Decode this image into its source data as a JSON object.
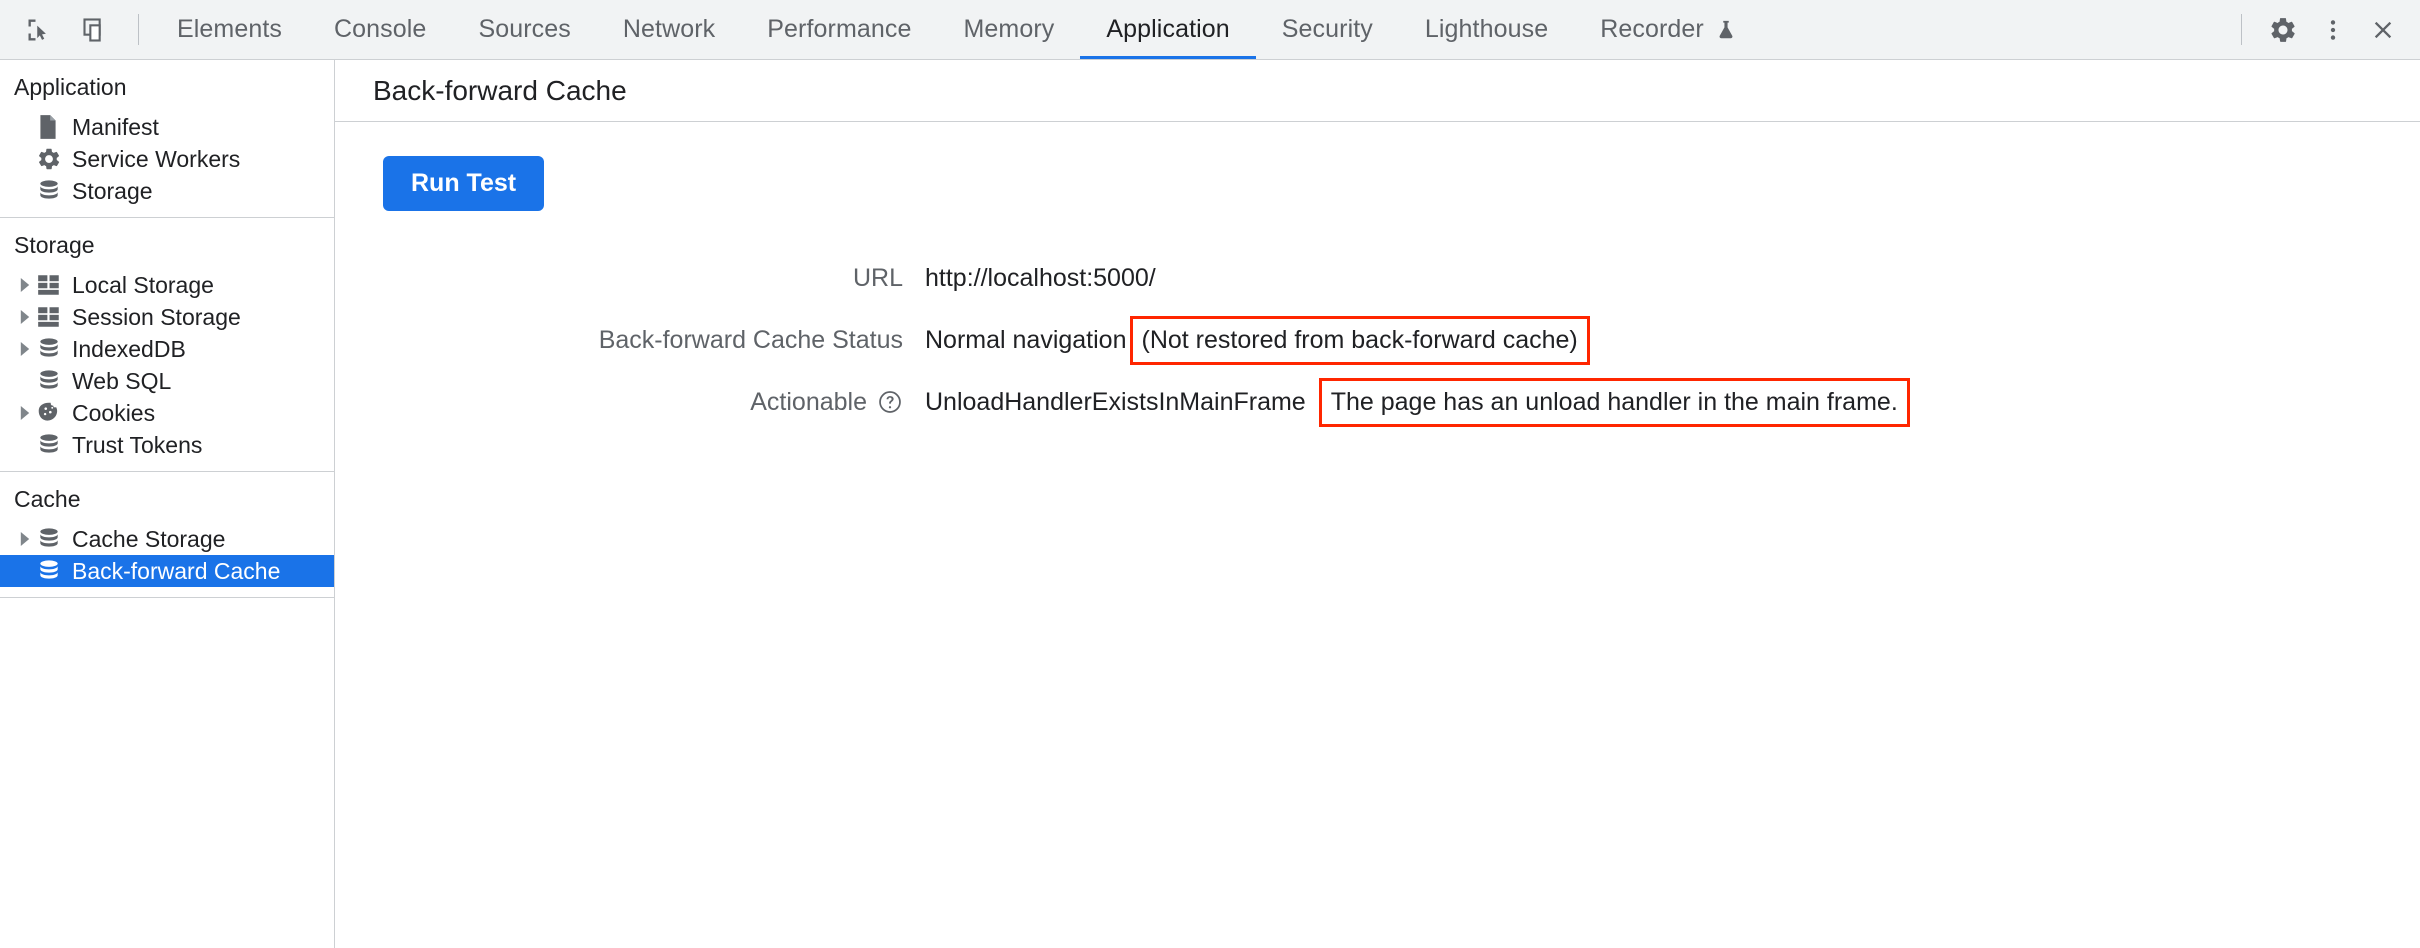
{
  "toolbar": {
    "inspect_icon": "inspect-cursor-icon",
    "device_icon": "device-toolbar-icon",
    "tabs": [
      {
        "label": "Elements",
        "active": false
      },
      {
        "label": "Console",
        "active": false
      },
      {
        "label": "Sources",
        "active": false
      },
      {
        "label": "Network",
        "active": false
      },
      {
        "label": "Performance",
        "active": false
      },
      {
        "label": "Memory",
        "active": false
      },
      {
        "label": "Application",
        "active": true
      },
      {
        "label": "Security",
        "active": false
      },
      {
        "label": "Lighthouse",
        "active": false
      },
      {
        "label": "Recorder",
        "active": false,
        "badge_icon": "flask-icon"
      }
    ],
    "settings_icon": "gear-icon",
    "more_icon": "more-vertical-icon",
    "close_icon": "close-icon",
    "accent_color": "#1a73e8",
    "background_color": "#f1f3f4"
  },
  "sidebar": {
    "groups": [
      {
        "title": "Application",
        "items": [
          {
            "label": "Manifest",
            "icon": "document-icon",
            "expandable": false,
            "selected": false
          },
          {
            "label": "Service Workers",
            "icon": "gear-icon",
            "expandable": false,
            "selected": false
          },
          {
            "label": "Storage",
            "icon": "database-icon",
            "expandable": false,
            "selected": false
          }
        ]
      },
      {
        "title": "Storage",
        "items": [
          {
            "label": "Local Storage",
            "icon": "table-icon",
            "expandable": true,
            "selected": false
          },
          {
            "label": "Session Storage",
            "icon": "table-icon",
            "expandable": true,
            "selected": false
          },
          {
            "label": "IndexedDB",
            "icon": "database-icon",
            "expandable": true,
            "selected": false
          },
          {
            "label": "Web SQL",
            "icon": "database-icon",
            "expandable": false,
            "selected": false
          },
          {
            "label": "Cookies",
            "icon": "cookie-icon",
            "expandable": true,
            "selected": false
          },
          {
            "label": "Trust Tokens",
            "icon": "database-icon",
            "expandable": false,
            "selected": false
          }
        ]
      },
      {
        "title": "Cache",
        "items": [
          {
            "label": "Cache Storage",
            "icon": "database-icon",
            "expandable": true,
            "selected": false
          },
          {
            "label": "Back-forward Cache",
            "icon": "database-icon",
            "expandable": false,
            "selected": true
          }
        ]
      }
    ],
    "selected_background": "#1a73e8"
  },
  "panel": {
    "title": "Back-forward Cache",
    "run_test_label": "Run Test",
    "rows": [
      {
        "label": "URL",
        "has_help": false,
        "value_plain": "http://localhost:5000/",
        "value_boxed": ""
      },
      {
        "label": "Back-forward Cache Status",
        "has_help": false,
        "value_plain": "Normal navigation",
        "value_boxed": "(Not restored from back-forward cache)"
      },
      {
        "label": "Actionable",
        "has_help": true,
        "help_icon": "help-circle-icon",
        "value_plain": "UnloadHandlerExistsInMainFrame",
        "value_boxed": "The page has an unload handler in the main frame."
      }
    ],
    "annotation_color": "#ff2600"
  }
}
